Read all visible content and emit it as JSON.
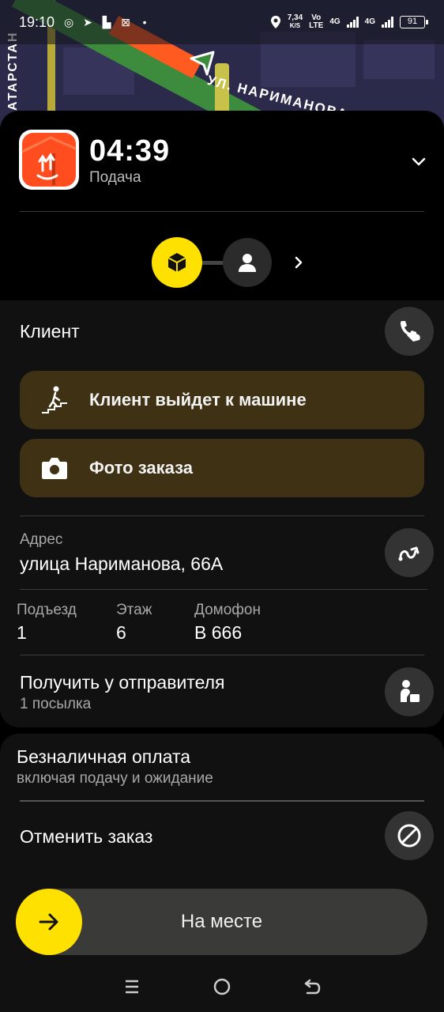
{
  "status_bar": {
    "time": "19:10",
    "speed_value": "7,34",
    "speed_unit": "K/S",
    "volte_top": "Vo",
    "volte_bottom": "LTE",
    "net1": "4G",
    "net2": "4G",
    "battery": "91"
  },
  "map": {
    "street_label": "УЛ. НАРИМАНОВА",
    "street_label_2": "АТАРСТАН"
  },
  "order": {
    "timer": "04:39",
    "timer_caption": "Подача"
  },
  "client": {
    "title": "Клиент",
    "walk_label": "Клиент выйдет к машине",
    "photo_label": "Фото заказа"
  },
  "address": {
    "label": "Адрес",
    "value": "улица Нариманова, 66А"
  },
  "details": {
    "entrance_label": "Подъезд",
    "entrance_value": "1",
    "floor_label": "Этаж",
    "floor_value": "6",
    "intercom_label": "Домофон",
    "intercom_value": "В 666"
  },
  "pickup": {
    "title": "Получить у отправителя",
    "subtitle": "1 посылка"
  },
  "payment": {
    "title": "Безналичная оплата",
    "subtitle": "включая подачу и ожидание"
  },
  "cancel": {
    "label": "Отменить заказ"
  },
  "slider": {
    "label": "На месте"
  },
  "colors": {
    "accent_yellow": "#ffe100",
    "action_bg": "#3f3214",
    "logo_orange": "#ff4d1f"
  }
}
